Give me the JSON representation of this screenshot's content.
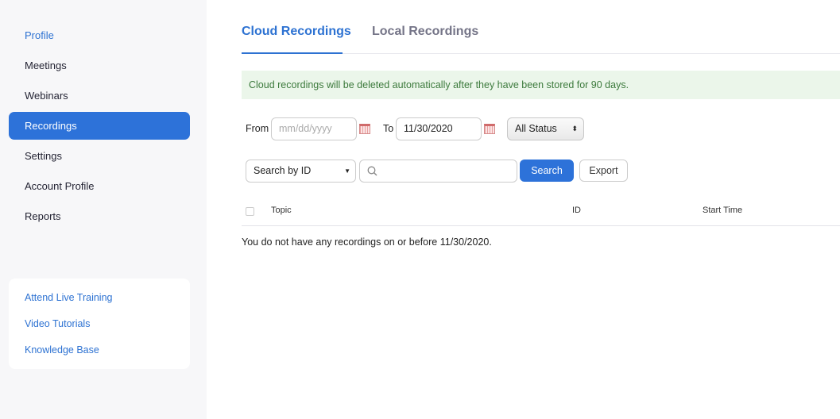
{
  "sidebar": {
    "items": [
      {
        "label": "Profile"
      },
      {
        "label": "Meetings"
      },
      {
        "label": "Webinars"
      },
      {
        "label": "Recordings"
      },
      {
        "label": "Settings"
      },
      {
        "label": "Account Profile"
      },
      {
        "label": "Reports"
      }
    ],
    "help": [
      {
        "label": "Attend Live Training"
      },
      {
        "label": "Video Tutorials"
      },
      {
        "label": "Knowledge Base"
      }
    ]
  },
  "tabs": [
    {
      "label": "Cloud Recordings"
    },
    {
      "label": "Local Recordings"
    }
  ],
  "notice": "Cloud recordings will be deleted automatically after they have been stored for 90 days.",
  "filters": {
    "from_label": "From",
    "from_placeholder": "mm/dd/yyyy",
    "to_label": "To",
    "to_value": "11/30/2020",
    "status": "All Status"
  },
  "search": {
    "type": "Search by  ID",
    "button": "Search",
    "export": "Export"
  },
  "table": {
    "columns": [
      "Topic",
      "ID",
      "Start Time"
    ],
    "empty": "You do not have any recordings on or before 11/30/2020."
  },
  "colors": {
    "accent": "#2d72d9",
    "notice_bg": "#ebf6ea"
  }
}
